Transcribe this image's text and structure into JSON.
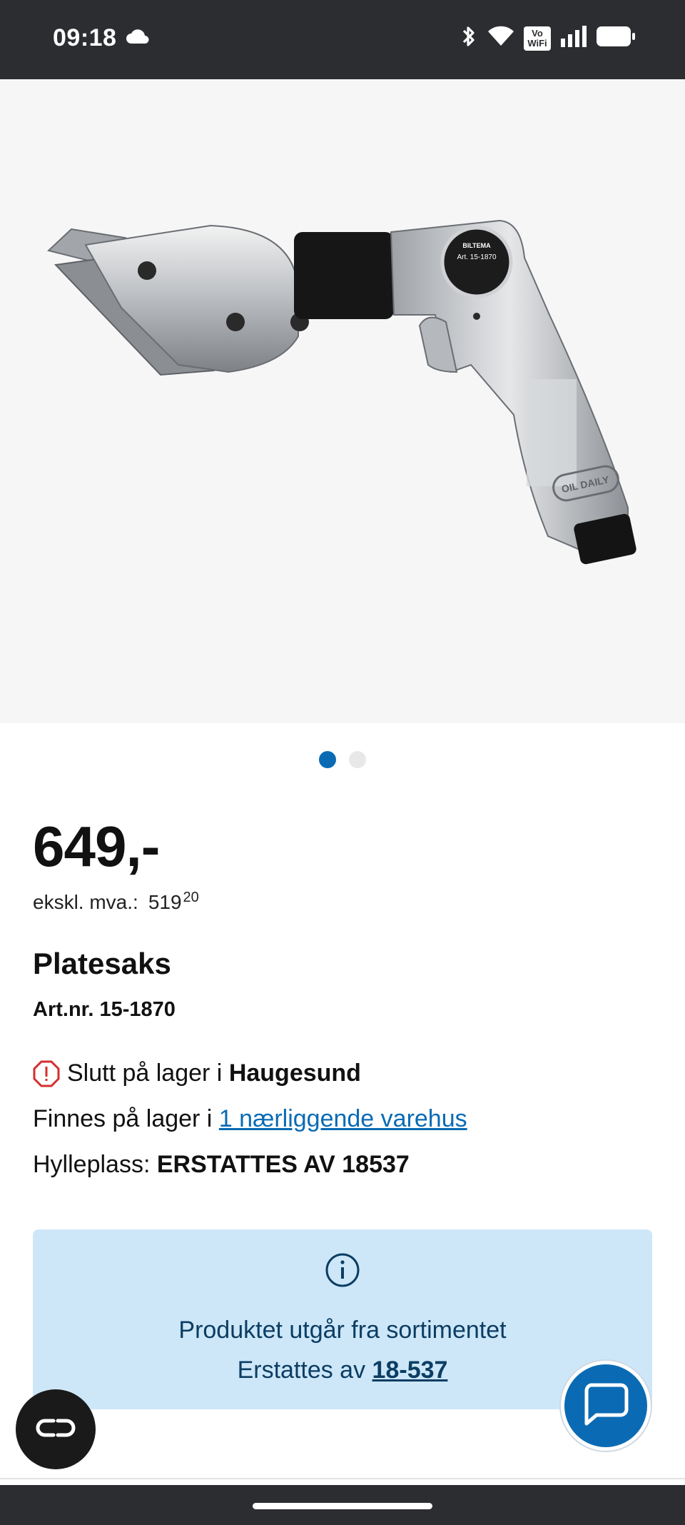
{
  "status_bar": {
    "time": "09:18",
    "network_badge": "Vo WiFi",
    "icons": [
      "cloud-icon",
      "bluetooth-icon",
      "wifi-icon",
      "vowifi-icon",
      "signal-icon",
      "battery-icon"
    ]
  },
  "gallery": {
    "image": "air-metal-shear-product-photo",
    "image_labels": [
      "BILTEMA",
      "Art. 15-1870",
      "OIL DAILY"
    ],
    "dot_count": 2,
    "active_dot": 1
  },
  "product": {
    "price": "649,-",
    "ex_vat_label": "ekskl. mva.:",
    "ex_vat_value": "519",
    "ex_vat_cents": "20",
    "title": "Platesaks",
    "art_nr": "Art.nr. 15-1870"
  },
  "stock": {
    "out_of_stock_prefix": "Slutt på lager i",
    "store": "Haugesund",
    "available_prefix": "Finnes på lager i",
    "available_link": "1 nærliggende varehus",
    "shelf_label": "Hylleplass:",
    "shelf_value": "ERSTATTES AV 18537"
  },
  "notice": {
    "line1": "Produktet utgår fra sortimentet",
    "line2_prefix": "Erstattes av",
    "line2_link": "18-537"
  },
  "colors": {
    "accent": "#0a6bb4",
    "notice_bg": "#cde7f8",
    "warning": "#d32f2f",
    "status_bar": "#2b2d30"
  }
}
